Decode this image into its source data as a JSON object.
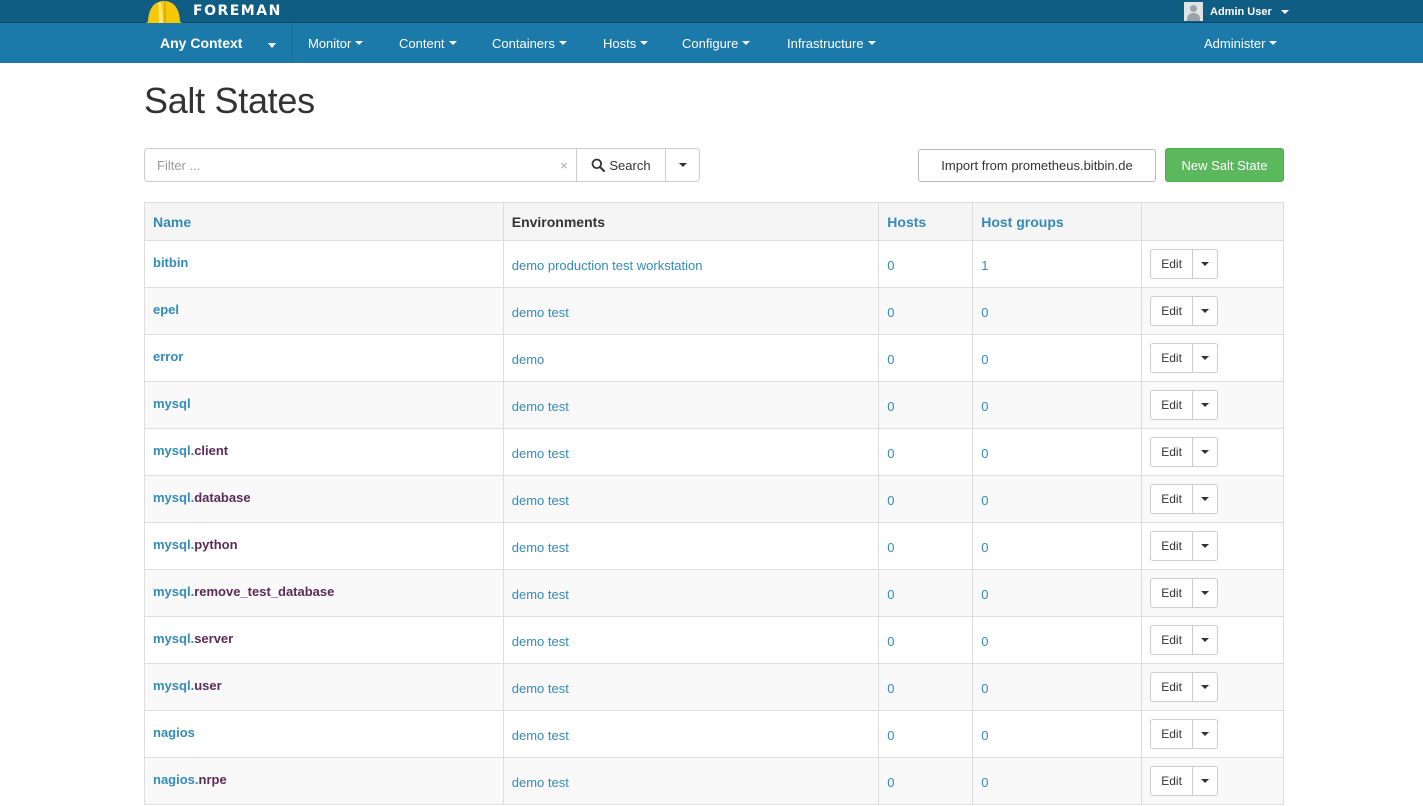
{
  "topbar": {
    "brand": "FOREMAN",
    "user_name": "Admin User"
  },
  "navbar": {
    "context": "Any Context",
    "menus": [
      "Monitor",
      "Content",
      "Containers",
      "Hosts",
      "Configure",
      "Infrastructure"
    ],
    "admin": "Administer"
  },
  "page": {
    "title": "Salt States"
  },
  "search": {
    "placeholder": "Filter ...",
    "clear": "×",
    "button_label": "Search"
  },
  "actions": {
    "import_label": "Import from prometheus.bitbin.de",
    "new_label": "New Salt State"
  },
  "table": {
    "headers": {
      "name": "Name",
      "environments": "Environments",
      "hosts": "Hosts",
      "host_groups": "Host groups"
    },
    "edit_label": "Edit",
    "rows": [
      {
        "name": "bitbin",
        "suffix": "",
        "environments": "demo production test workstation",
        "hosts": "0",
        "host_groups": "1"
      },
      {
        "name": "epel",
        "suffix": "",
        "environments": "demo test",
        "hosts": "0",
        "host_groups": "0"
      },
      {
        "name": "error",
        "suffix": "",
        "environments": "demo",
        "hosts": "0",
        "host_groups": "0"
      },
      {
        "name": "mysql",
        "suffix": "",
        "environments": "demo test",
        "hosts": "0",
        "host_groups": "0"
      },
      {
        "name": "mysql.",
        "suffix": "client",
        "environments": "demo test",
        "hosts": "0",
        "host_groups": "0"
      },
      {
        "name": "mysql.",
        "suffix": "database",
        "environments": "demo test",
        "hosts": "0",
        "host_groups": "0"
      },
      {
        "name": "mysql.",
        "suffix": "python",
        "environments": "demo test",
        "hosts": "0",
        "host_groups": "0"
      },
      {
        "name": "mysql.",
        "suffix": "remove_test_database",
        "environments": "demo test",
        "hosts": "0",
        "host_groups": "0"
      },
      {
        "name": "mysql.",
        "suffix": "server",
        "environments": "demo test",
        "hosts": "0",
        "host_groups": "0"
      },
      {
        "name": "mysql.",
        "suffix": "user",
        "environments": "demo test",
        "hosts": "0",
        "host_groups": "0"
      },
      {
        "name": "nagios",
        "suffix": "",
        "environments": "demo test",
        "hosts": "0",
        "host_groups": "0"
      },
      {
        "name": "nagios.",
        "suffix": "nrpe",
        "environments": "demo test",
        "hosts": "0",
        "host_groups": "0"
      }
    ]
  },
  "colors": {
    "topbar": "#0f5d82",
    "navbar": "#1b7aaa",
    "link": "#338bb8",
    "name_suffix": "#5a2c56",
    "new_button": "#5cb85c"
  },
  "icons": {
    "logo": "helmet-logo-icon",
    "search": "search-icon",
    "caret": "caret-down-icon"
  }
}
